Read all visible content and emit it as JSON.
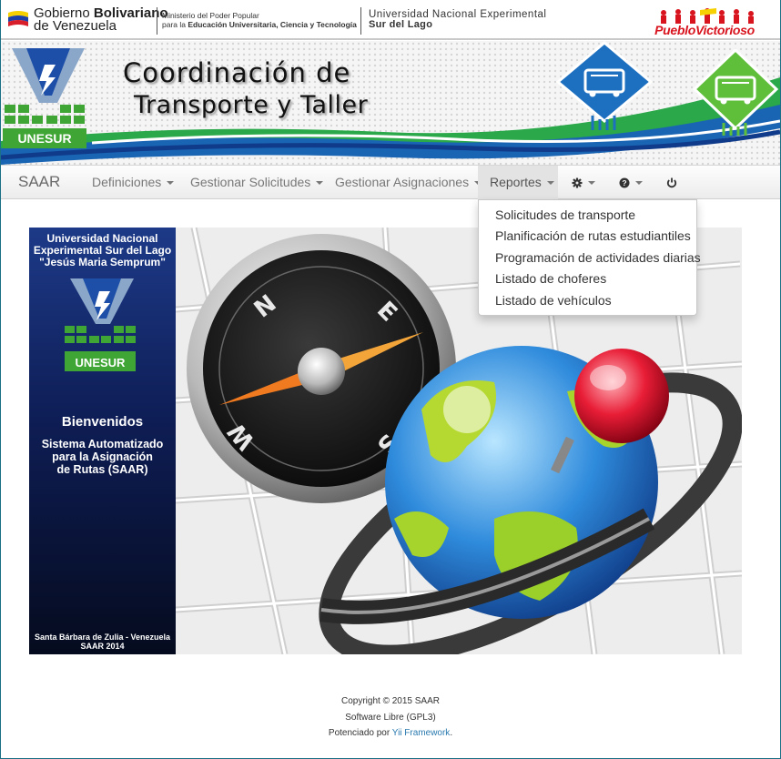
{
  "gov_bar": {
    "gov_line1_a": "Gobierno ",
    "gov_line1_b": "Bolivariano",
    "gov_line2": "de Venezuela",
    "ministry_line1": "Ministerio del Poder Popular",
    "ministry_line2_a": "para la ",
    "ministry_line2_b": "Educación Universitaria, Ciencia y Tecnología",
    "university_line1": "Universidad Nacional Experimental",
    "university_line2": "Sur del Lago",
    "pueblo_logo": "PuebloVictorioso"
  },
  "banner": {
    "title_line1": "Coordinación de",
    "title_line2": "Transporte y Taller",
    "logo_text": "UNESUR"
  },
  "navbar": {
    "brand": "SAAR",
    "items": [
      {
        "label": "Definiciones"
      },
      {
        "label": "Gestionar Solicitudes"
      },
      {
        "label": "Gestionar Asignaciones"
      },
      {
        "label": "Reportes"
      }
    ],
    "settings_icon": "gear-icon",
    "help_icon": "question-circle-icon",
    "power_icon": "power-icon"
  },
  "dropdown": {
    "items": [
      "Solicitudes de transporte",
      "Planificación de rutas estudiantiles",
      "Programación de actividades diarias",
      "Listado de choferes",
      "Listado de vehículos"
    ]
  },
  "welcome_panel": {
    "uni_line1": "Universidad Nacional",
    "uni_line2": "Experimental Sur del Lago",
    "uni_line3": "\"Jesús Maria Semprum\"",
    "logo_text": "UNESUR",
    "welcome": "Bienvenidos",
    "system_line1": "Sistema Automatizado",
    "system_line2": "para la Asignación",
    "system_line3": "de Rutas (SAAR)",
    "footer_line1": "Santa Bárbara de Zulia - Venezuela",
    "footer_line2": "SAAR 2014"
  },
  "compass_letters": [
    "N",
    "E",
    "S",
    "W"
  ],
  "footer": {
    "copyright": "Copyright © 2015 SAAR",
    "license": "Software Libre (GPL3)",
    "powered_prefix": "Potenciado por ",
    "powered_link": "Yii Framework",
    "powered_suffix": "."
  },
  "colors": {
    "accent_blue": "#1d3a88",
    "unesur_green": "#3fa535",
    "brand_red": "#d8141e",
    "link": "#2a7ab0"
  }
}
